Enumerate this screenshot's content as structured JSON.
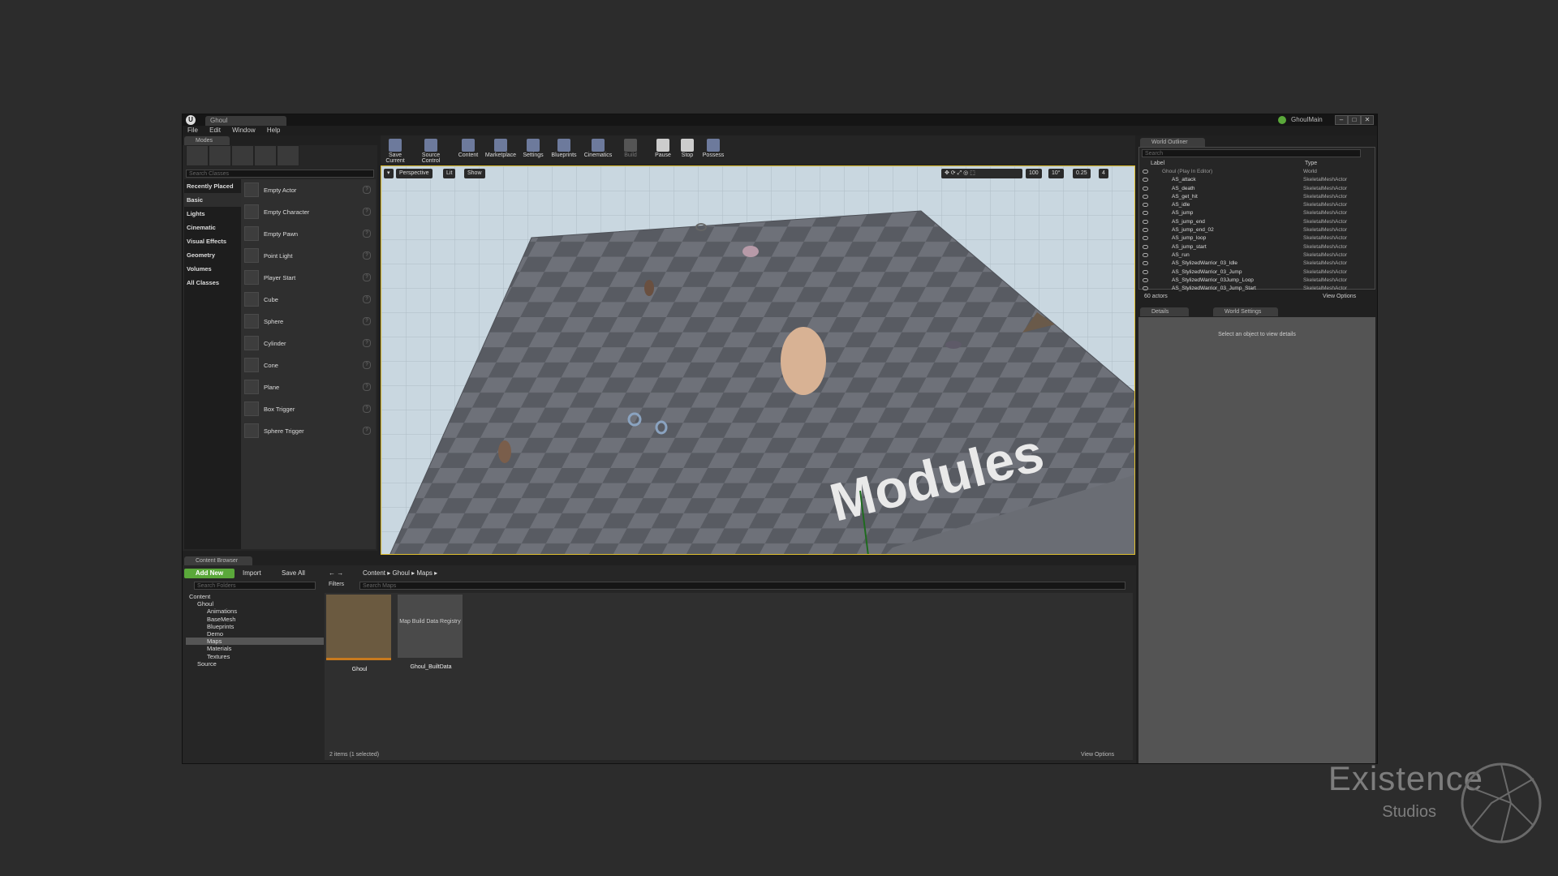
{
  "window": {
    "tab_title": "Ghoul",
    "project_name": "GhoulMain",
    "menu": [
      "File",
      "Edit",
      "Window",
      "Help"
    ]
  },
  "modes": {
    "tab_label": "Modes",
    "search_placeholder": "Search Classes",
    "categories": [
      "Recently Placed",
      "Basic",
      "Lights",
      "Cinematic",
      "Visual Effects",
      "Geometry",
      "Volumes",
      "All Classes"
    ],
    "selected_category": "Basic",
    "items": [
      "Empty Actor",
      "Empty Character",
      "Empty Pawn",
      "Point Light",
      "Player Start",
      "Cube",
      "Sphere",
      "Cylinder",
      "Cone",
      "Plane",
      "Box Trigger",
      "Sphere Trigger"
    ]
  },
  "toolbar": {
    "buttons": [
      "Save Current",
      "Source Control",
      "Content",
      "Marketplace",
      "Settings",
      "Blueprints",
      "Cinematics",
      "Build",
      "Pause",
      "Stop",
      "Possess"
    ]
  },
  "viewport": {
    "perspective": "Perspective",
    "lit": "Lit",
    "show": "Show",
    "grid_snap": "100",
    "rotation_snap": "10°",
    "scale_snap": "0.25",
    "camera_speed": "4",
    "scene_text": "Modules"
  },
  "outliner": {
    "tab_label": "World Outliner",
    "search_placeholder": "Search",
    "col_label": "Label",
    "col_type": "Type",
    "rows": [
      {
        "label": "Ghoul (Play In Editor)",
        "type": "World"
      },
      {
        "label": "AS_attack",
        "type": "SkeletalMeshActor"
      },
      {
        "label": "AS_death",
        "type": "SkeletalMeshActor"
      },
      {
        "label": "AS_get_hit",
        "type": "SkeletalMeshActor"
      },
      {
        "label": "AS_idle",
        "type": "SkeletalMeshActor"
      },
      {
        "label": "AS_jump",
        "type": "SkeletalMeshActor"
      },
      {
        "label": "AS_jump_end",
        "type": "SkeletalMeshActor"
      },
      {
        "label": "AS_jump_end_02",
        "type": "SkeletalMeshActor"
      },
      {
        "label": "AS_jump_loop",
        "type": "SkeletalMeshActor"
      },
      {
        "label": "AS_jump_start",
        "type": "SkeletalMeshActor"
      },
      {
        "label": "AS_run",
        "type": "SkeletalMeshActor"
      },
      {
        "label": "AS_StylizedWarrior_03_Idle",
        "type": "SkeletalMeshActor"
      },
      {
        "label": "AS_StylizedWarrior_03_Jump",
        "type": "SkeletalMeshActor"
      },
      {
        "label": "AS_StylizedWarrior_03Jump_Loop",
        "type": "SkeletalMeshActor"
      },
      {
        "label": "AS_StylizedWarrior_03_Jump_Start",
        "type": "SkeletalMeshActor"
      }
    ],
    "actor_count": "60 actors",
    "view_options": "View Options"
  },
  "details": {
    "tab_details": "Details",
    "tab_world_settings": "World Settings",
    "empty_message": "Select an object to view details"
  },
  "content_browser": {
    "tab_label": "Content Browser",
    "add_new": "Add New",
    "import": "Import",
    "save_all": "Save All",
    "breadcrumb": [
      "Content",
      "Ghoul",
      "Maps"
    ],
    "folder_search_placeholder": "Search Folders",
    "filters": "Filters",
    "asset_search_placeholder": "Search Maps",
    "folders": [
      {
        "name": "Content",
        "depth": 0
      },
      {
        "name": "Ghoul",
        "depth": 1
      },
      {
        "name": "Animations",
        "depth": 2
      },
      {
        "name": "BaseMesh",
        "depth": 2
      },
      {
        "name": "Blueprints",
        "depth": 2
      },
      {
        "name": "Demo",
        "depth": 2
      },
      {
        "name": "Maps",
        "depth": 2
      },
      {
        "name": "Materials",
        "depth": 2
      },
      {
        "name": "Textures",
        "depth": 2
      },
      {
        "name": "Source",
        "depth": 1
      }
    ],
    "selected_folder": "Maps",
    "assets": [
      {
        "name": "Ghoul",
        "thumb_text": ""
      },
      {
        "name": "Ghoul_BuiltData",
        "thumb_text": "Map Build Data Registry"
      }
    ],
    "status": "2 items (1 selected)",
    "view_options": "View Options"
  },
  "watermark": {
    "name": "Existence",
    "sub": "Studios"
  },
  "colors": {
    "accent_green": "#5aa83a",
    "selection_orange": "#c87a1e",
    "viewport_border": "#e0c030"
  }
}
